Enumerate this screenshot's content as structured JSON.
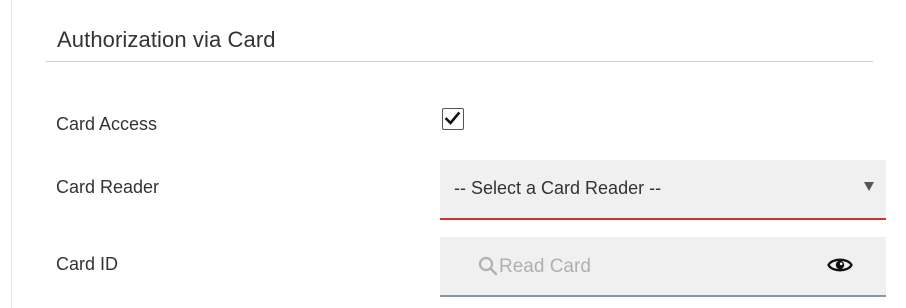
{
  "section": {
    "title": "Authorization via Card"
  },
  "fields": {
    "card_access": {
      "label": "Card Access",
      "checked": true
    },
    "card_reader": {
      "label": "Card Reader",
      "selected": "-- Select a Card Reader --"
    },
    "card_id": {
      "label": "Card ID",
      "placeholder": "Read Card",
      "value": ""
    }
  },
  "icons": {
    "check": "checkmark-icon",
    "dropdown": "chevron-down-icon",
    "search": "search-icon",
    "reveal": "eye-icon"
  },
  "colors": {
    "error_underline": "#d32f2f",
    "field_background": "#f0f0f0",
    "input_underline": "#8a97a8",
    "placeholder": "#b0b0b0",
    "text": "#333333"
  }
}
